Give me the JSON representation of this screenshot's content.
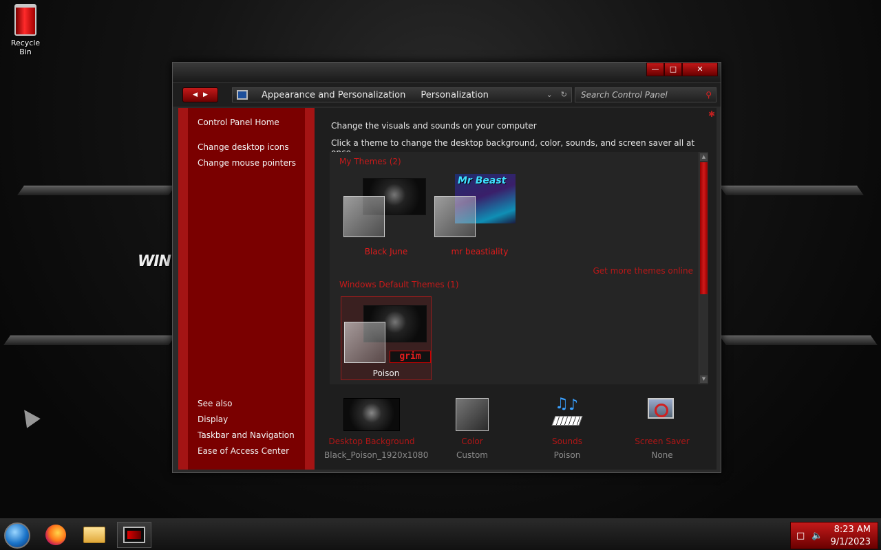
{
  "desktop": {
    "recycle_bin_label": "Recycle Bin",
    "wallpaper_text": "WIN"
  },
  "window": {
    "caption": {
      "minimize": "—",
      "maximize": "□",
      "close": "✕"
    },
    "address": {
      "crumbs": [
        "Appearance and Personalization",
        "Personalization"
      ],
      "dropdown_glyph": "⌄",
      "refresh_glyph": "↻"
    },
    "search_placeholder": "Search Control Panel",
    "left_pane": {
      "home": "Control Panel Home",
      "links": [
        "Change desktop icons",
        "Change mouse pointers"
      ],
      "see_also_title": "See also",
      "see_also": [
        "Display",
        "Taskbar and Navigation",
        "Ease of Access Center"
      ]
    },
    "main": {
      "heading": "Change the visuals and sounds on your computer",
      "subheading": "Click a theme to change the desktop background, color, sounds, and screen saver all at once.",
      "my_themes_title": "My Themes (2)",
      "my_themes": [
        {
          "name": "Black June"
        },
        {
          "name": "mr beastiality",
          "thumb_text": "Mr Beast"
        }
      ],
      "get_more_link": "Get more themes online",
      "default_themes_title": "Windows Default Themes (1)",
      "default_themes": [
        {
          "name": "Poison",
          "badge_text": "grim",
          "selected": true
        }
      ]
    },
    "settings": [
      {
        "label": "Desktop Background",
        "value": "Black_Poison_1920x1080"
      },
      {
        "label": "Color",
        "value": "Custom"
      },
      {
        "label": "Sounds",
        "value": "Poison"
      },
      {
        "label": "Screen Saver",
        "value": "None"
      }
    ]
  },
  "taskbar": {
    "apps": [
      "Firefox",
      "File Explorer",
      "Control Panel"
    ],
    "time": "8:23 AM",
    "date": "9/1/2023"
  },
  "colors": {
    "accent_red": "#c41a1a",
    "left_pane_red": "#7a0000",
    "link_red": "#c81a1a"
  }
}
